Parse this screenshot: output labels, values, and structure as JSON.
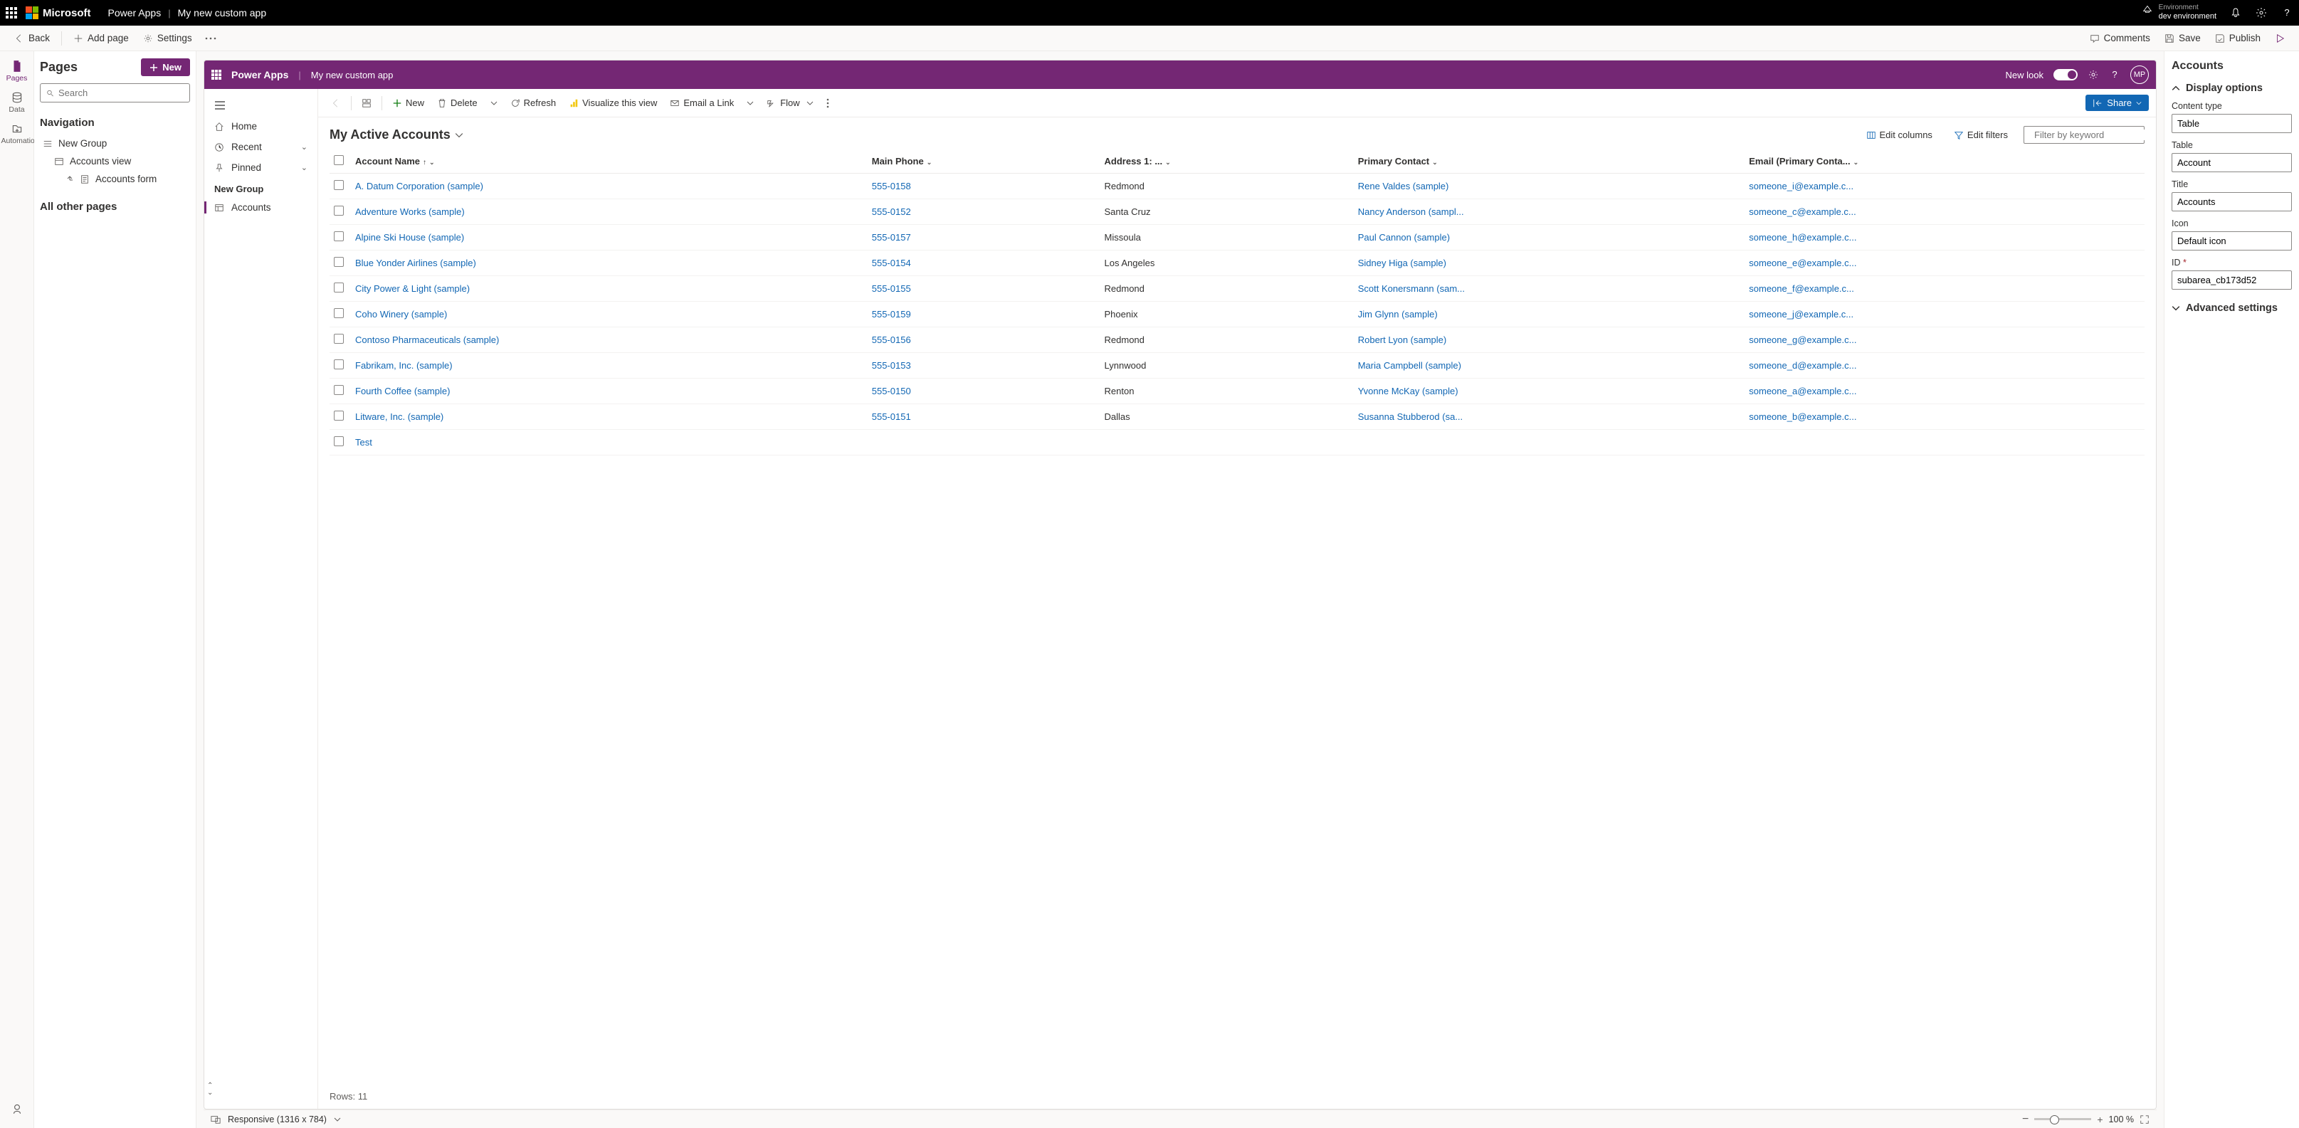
{
  "topbar": {
    "brand": "Microsoft",
    "product": "Power Apps",
    "app_name": "My new custom app",
    "env_label": "Environment",
    "env_name": "dev environment"
  },
  "cmdbar": {
    "back": "Back",
    "add_page": "Add page",
    "settings": "Settings",
    "comments": "Comments",
    "save": "Save",
    "publish": "Publish"
  },
  "rail": {
    "pages": "Pages",
    "data": "Data",
    "automation": "Automation"
  },
  "pages_panel": {
    "title": "Pages",
    "new": "New",
    "search_placeholder": "Search",
    "navigation": "Navigation",
    "group": "New Group",
    "accounts_view": "Accounts view",
    "accounts_form": "Accounts form",
    "all_other": "All other pages"
  },
  "app_header": {
    "name": "Power Apps",
    "app": "My new custom app",
    "new_look": "New look",
    "avatar": "MP"
  },
  "app_nav": {
    "home": "Home",
    "recent": "Recent",
    "pinned": "Pinned",
    "group": "New Group",
    "accounts": "Accounts"
  },
  "grid_cmd": {
    "new": "New",
    "delete": "Delete",
    "refresh": "Refresh",
    "visualize": "Visualize this view",
    "email": "Email a Link",
    "flow": "Flow",
    "share": "Share"
  },
  "grid": {
    "title": "My Active Accounts",
    "edit_columns": "Edit columns",
    "edit_filters": "Edit filters",
    "filter_placeholder": "Filter by keyword",
    "cols": {
      "name": "Account Name",
      "phone": "Main Phone",
      "city": "Address 1: ...",
      "contact": "Primary Contact",
      "email": "Email (Primary Conta..."
    },
    "rows": [
      {
        "name": "A. Datum Corporation (sample)",
        "phone": "555-0158",
        "city": "Redmond",
        "contact": "Rene Valdes (sample)",
        "email": "someone_i@example.c..."
      },
      {
        "name": "Adventure Works (sample)",
        "phone": "555-0152",
        "city": "Santa Cruz",
        "contact": "Nancy Anderson (sampl...",
        "email": "someone_c@example.c..."
      },
      {
        "name": "Alpine Ski House (sample)",
        "phone": "555-0157",
        "city": "Missoula",
        "contact": "Paul Cannon (sample)",
        "email": "someone_h@example.c..."
      },
      {
        "name": "Blue Yonder Airlines (sample)",
        "phone": "555-0154",
        "city": "Los Angeles",
        "contact": "Sidney Higa (sample)",
        "email": "someone_e@example.c..."
      },
      {
        "name": "City Power & Light (sample)",
        "phone": "555-0155",
        "city": "Redmond",
        "contact": "Scott Konersmann (sam...",
        "email": "someone_f@example.c..."
      },
      {
        "name": "Coho Winery (sample)",
        "phone": "555-0159",
        "city": "Phoenix",
        "contact": "Jim Glynn (sample)",
        "email": "someone_j@example.c..."
      },
      {
        "name": "Contoso Pharmaceuticals (sample)",
        "phone": "555-0156",
        "city": "Redmond",
        "contact": "Robert Lyon (sample)",
        "email": "someone_g@example.c..."
      },
      {
        "name": "Fabrikam, Inc. (sample)",
        "phone": "555-0153",
        "city": "Lynnwood",
        "contact": "Maria Campbell (sample)",
        "email": "someone_d@example.c..."
      },
      {
        "name": "Fourth Coffee (sample)",
        "phone": "555-0150",
        "city": "Renton",
        "contact": "Yvonne McKay (sample)",
        "email": "someone_a@example.c..."
      },
      {
        "name": "Litware, Inc. (sample)",
        "phone": "555-0151",
        "city": "Dallas",
        "contact": "Susanna Stubberod (sa...",
        "email": "someone_b@example.c..."
      },
      {
        "name": "Test",
        "phone": "",
        "city": "",
        "contact": "",
        "email": ""
      }
    ],
    "rows_label": "Rows: 11"
  },
  "status": {
    "responsive": "Responsive (1316 x 784)",
    "zoom": "100 %"
  },
  "props": {
    "title": "Accounts",
    "display_options": "Display options",
    "content_type_label": "Content type",
    "content_type": "Table",
    "table_label": "Table",
    "table": "Account",
    "title_label": "Title",
    "title_value": "Accounts",
    "icon_label": "Icon",
    "icon": "Default icon",
    "id_label": "ID",
    "id": "subarea_cb173d52",
    "advanced": "Advanced settings"
  }
}
